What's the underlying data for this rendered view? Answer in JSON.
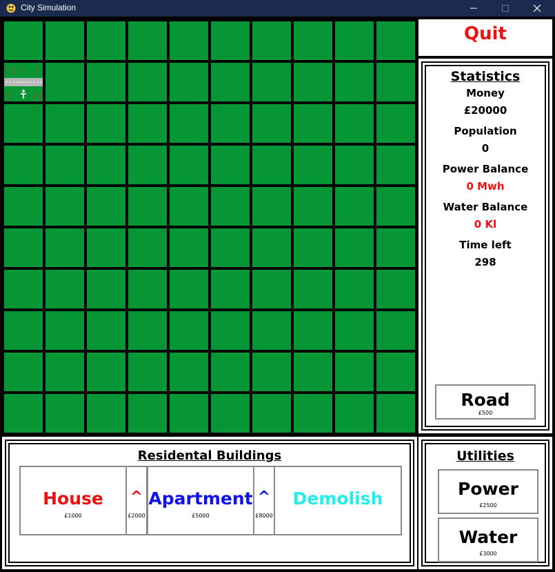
{
  "window": {
    "title": "City Simulation"
  },
  "quit": {
    "label": "Quit"
  },
  "grid": {
    "rows": 10,
    "cols": 10,
    "grass_color": "#069636",
    "placed": [
      {
        "row": 1,
        "col": 0,
        "type": "park"
      }
    ]
  },
  "stats": {
    "heading": "Statistics",
    "items": [
      {
        "label": "Money",
        "value": "£20000",
        "value_color": "#000000"
      },
      {
        "label": "Population",
        "value": "0",
        "value_color": "#000000"
      },
      {
        "label": "Power Balance",
        "value": "0 Mwh",
        "value_color": "#ee1111"
      },
      {
        "label": "Water Balance",
        "value": "0 Kl",
        "value_color": "#ee1111"
      },
      {
        "label": "Time left",
        "value": "298",
        "value_color": "#000000"
      }
    ]
  },
  "road": {
    "label": "Road",
    "price": "£500"
  },
  "residential": {
    "heading": "Residental Buildings",
    "house": {
      "label": "House",
      "price": "£1000",
      "color": "#ee1111"
    },
    "house_upgrade": {
      "label": "^",
      "price": "£2000",
      "color": "#ee1111"
    },
    "apartment": {
      "label": "Apartment",
      "price": "£5000",
      "color": "#1111ee"
    },
    "apartment_upgrade": {
      "label": "^",
      "price": "£8000",
      "color": "#1111ee"
    },
    "demolish": {
      "label": "Demolish",
      "color": "#22eeee"
    }
  },
  "utilities": {
    "heading": "Utilities",
    "power": {
      "label": "Power",
      "price": "£2500"
    },
    "water": {
      "label": "Water",
      "price": "£3000"
    }
  }
}
